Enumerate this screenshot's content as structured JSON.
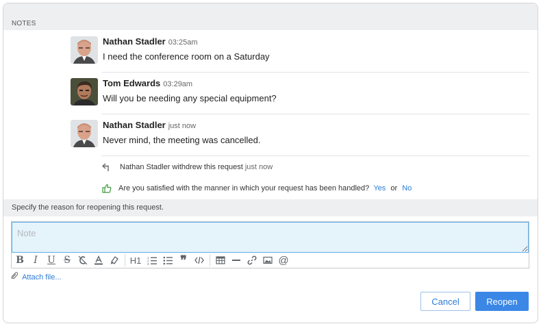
{
  "section": {
    "title": "NOTES"
  },
  "notes": [
    {
      "author": "Nathan Stadler",
      "time": "03:25am",
      "message": "I need the conference room on a Saturday",
      "avatar_icon": "person-photo-bald"
    },
    {
      "author": "Tom Edwards",
      "time": "03:29am",
      "message": "Will you be needing any special equipment?",
      "avatar_icon": "person-photo-hair"
    },
    {
      "author": "Nathan Stadler",
      "time": "just now",
      "message": "Never mind, the meeting was cancelled.",
      "avatar_icon": "person-photo-bald"
    }
  ],
  "events": {
    "withdraw": {
      "text": "Nathan Stadler withdrew this request",
      "time": "just now",
      "icon": "withdraw-arrow-icon"
    },
    "satisfaction": {
      "question": "Are you satisfied with the manner in which your request has been handled?",
      "yes": "Yes",
      "or": "or",
      "no": "No",
      "icon": "thumbs-up-icon"
    }
  },
  "reopen": {
    "prompt": "Specify the reason for reopening this request.",
    "placeholder": "Note",
    "attach_label": "Attach file...",
    "cancel_label": "Cancel",
    "reopen_label": "Reopen"
  },
  "toolbar": {
    "tools": [
      "bold",
      "italic",
      "underline",
      "strikethrough",
      "clear-format",
      "text-color",
      "highlight",
      "heading",
      "ordered-list",
      "bullet-list",
      "quote",
      "code",
      "table",
      "horizontal-rule",
      "link",
      "image",
      "mention"
    ]
  },
  "colors": {
    "accent": "#3b87e6",
    "link": "#2b7bd6",
    "input_bg": "#e5f3fb",
    "header_bg": "#eeeff1"
  }
}
